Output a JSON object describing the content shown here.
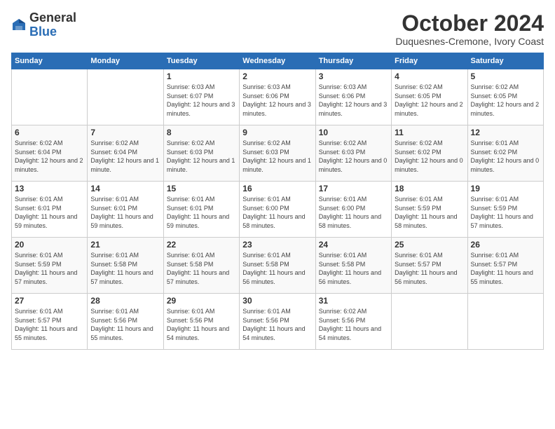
{
  "header": {
    "logo_general": "General",
    "logo_blue": "Blue",
    "month": "October 2024",
    "location": "Duquesnes-Cremone, Ivory Coast"
  },
  "weekdays": [
    "Sunday",
    "Monday",
    "Tuesday",
    "Wednesday",
    "Thursday",
    "Friday",
    "Saturday"
  ],
  "weeks": [
    [
      {
        "day": "",
        "info": ""
      },
      {
        "day": "",
        "info": ""
      },
      {
        "day": "1",
        "info": "Sunrise: 6:03 AM\nSunset: 6:07 PM\nDaylight: 12 hours\nand 3 minutes."
      },
      {
        "day": "2",
        "info": "Sunrise: 6:03 AM\nSunset: 6:06 PM\nDaylight: 12 hours\nand 3 minutes."
      },
      {
        "day": "3",
        "info": "Sunrise: 6:03 AM\nSunset: 6:06 PM\nDaylight: 12 hours\nand 3 minutes."
      },
      {
        "day": "4",
        "info": "Sunrise: 6:02 AM\nSunset: 6:05 PM\nDaylight: 12 hours\nand 2 minutes."
      },
      {
        "day": "5",
        "info": "Sunrise: 6:02 AM\nSunset: 6:05 PM\nDaylight: 12 hours\nand 2 minutes."
      }
    ],
    [
      {
        "day": "6",
        "info": "Sunrise: 6:02 AM\nSunset: 6:04 PM\nDaylight: 12 hours\nand 2 minutes."
      },
      {
        "day": "7",
        "info": "Sunrise: 6:02 AM\nSunset: 6:04 PM\nDaylight: 12 hours\nand 1 minute."
      },
      {
        "day": "8",
        "info": "Sunrise: 6:02 AM\nSunset: 6:03 PM\nDaylight: 12 hours\nand 1 minute."
      },
      {
        "day": "9",
        "info": "Sunrise: 6:02 AM\nSunset: 6:03 PM\nDaylight: 12 hours\nand 1 minute."
      },
      {
        "day": "10",
        "info": "Sunrise: 6:02 AM\nSunset: 6:03 PM\nDaylight: 12 hours\nand 0 minutes."
      },
      {
        "day": "11",
        "info": "Sunrise: 6:02 AM\nSunset: 6:02 PM\nDaylight: 12 hours\nand 0 minutes."
      },
      {
        "day": "12",
        "info": "Sunrise: 6:01 AM\nSunset: 6:02 PM\nDaylight: 12 hours\nand 0 minutes."
      }
    ],
    [
      {
        "day": "13",
        "info": "Sunrise: 6:01 AM\nSunset: 6:01 PM\nDaylight: 11 hours\nand 59 minutes."
      },
      {
        "day": "14",
        "info": "Sunrise: 6:01 AM\nSunset: 6:01 PM\nDaylight: 11 hours\nand 59 minutes."
      },
      {
        "day": "15",
        "info": "Sunrise: 6:01 AM\nSunset: 6:01 PM\nDaylight: 11 hours\nand 59 minutes."
      },
      {
        "day": "16",
        "info": "Sunrise: 6:01 AM\nSunset: 6:00 PM\nDaylight: 11 hours\nand 58 minutes."
      },
      {
        "day": "17",
        "info": "Sunrise: 6:01 AM\nSunset: 6:00 PM\nDaylight: 11 hours\nand 58 minutes."
      },
      {
        "day": "18",
        "info": "Sunrise: 6:01 AM\nSunset: 5:59 PM\nDaylight: 11 hours\nand 58 minutes."
      },
      {
        "day": "19",
        "info": "Sunrise: 6:01 AM\nSunset: 5:59 PM\nDaylight: 11 hours\nand 57 minutes."
      }
    ],
    [
      {
        "day": "20",
        "info": "Sunrise: 6:01 AM\nSunset: 5:59 PM\nDaylight: 11 hours\nand 57 minutes."
      },
      {
        "day": "21",
        "info": "Sunrise: 6:01 AM\nSunset: 5:58 PM\nDaylight: 11 hours\nand 57 minutes."
      },
      {
        "day": "22",
        "info": "Sunrise: 6:01 AM\nSunset: 5:58 PM\nDaylight: 11 hours\nand 57 minutes."
      },
      {
        "day": "23",
        "info": "Sunrise: 6:01 AM\nSunset: 5:58 PM\nDaylight: 11 hours\nand 56 minutes."
      },
      {
        "day": "24",
        "info": "Sunrise: 6:01 AM\nSunset: 5:58 PM\nDaylight: 11 hours\nand 56 minutes."
      },
      {
        "day": "25",
        "info": "Sunrise: 6:01 AM\nSunset: 5:57 PM\nDaylight: 11 hours\nand 56 minutes."
      },
      {
        "day": "26",
        "info": "Sunrise: 6:01 AM\nSunset: 5:57 PM\nDaylight: 11 hours\nand 55 minutes."
      }
    ],
    [
      {
        "day": "27",
        "info": "Sunrise: 6:01 AM\nSunset: 5:57 PM\nDaylight: 11 hours\nand 55 minutes."
      },
      {
        "day": "28",
        "info": "Sunrise: 6:01 AM\nSunset: 5:56 PM\nDaylight: 11 hours\nand 55 minutes."
      },
      {
        "day": "29",
        "info": "Sunrise: 6:01 AM\nSunset: 5:56 PM\nDaylight: 11 hours\nand 54 minutes."
      },
      {
        "day": "30",
        "info": "Sunrise: 6:01 AM\nSunset: 5:56 PM\nDaylight: 11 hours\nand 54 minutes."
      },
      {
        "day": "31",
        "info": "Sunrise: 6:02 AM\nSunset: 5:56 PM\nDaylight: 11 hours\nand 54 minutes."
      },
      {
        "day": "",
        "info": ""
      },
      {
        "day": "",
        "info": ""
      }
    ]
  ]
}
